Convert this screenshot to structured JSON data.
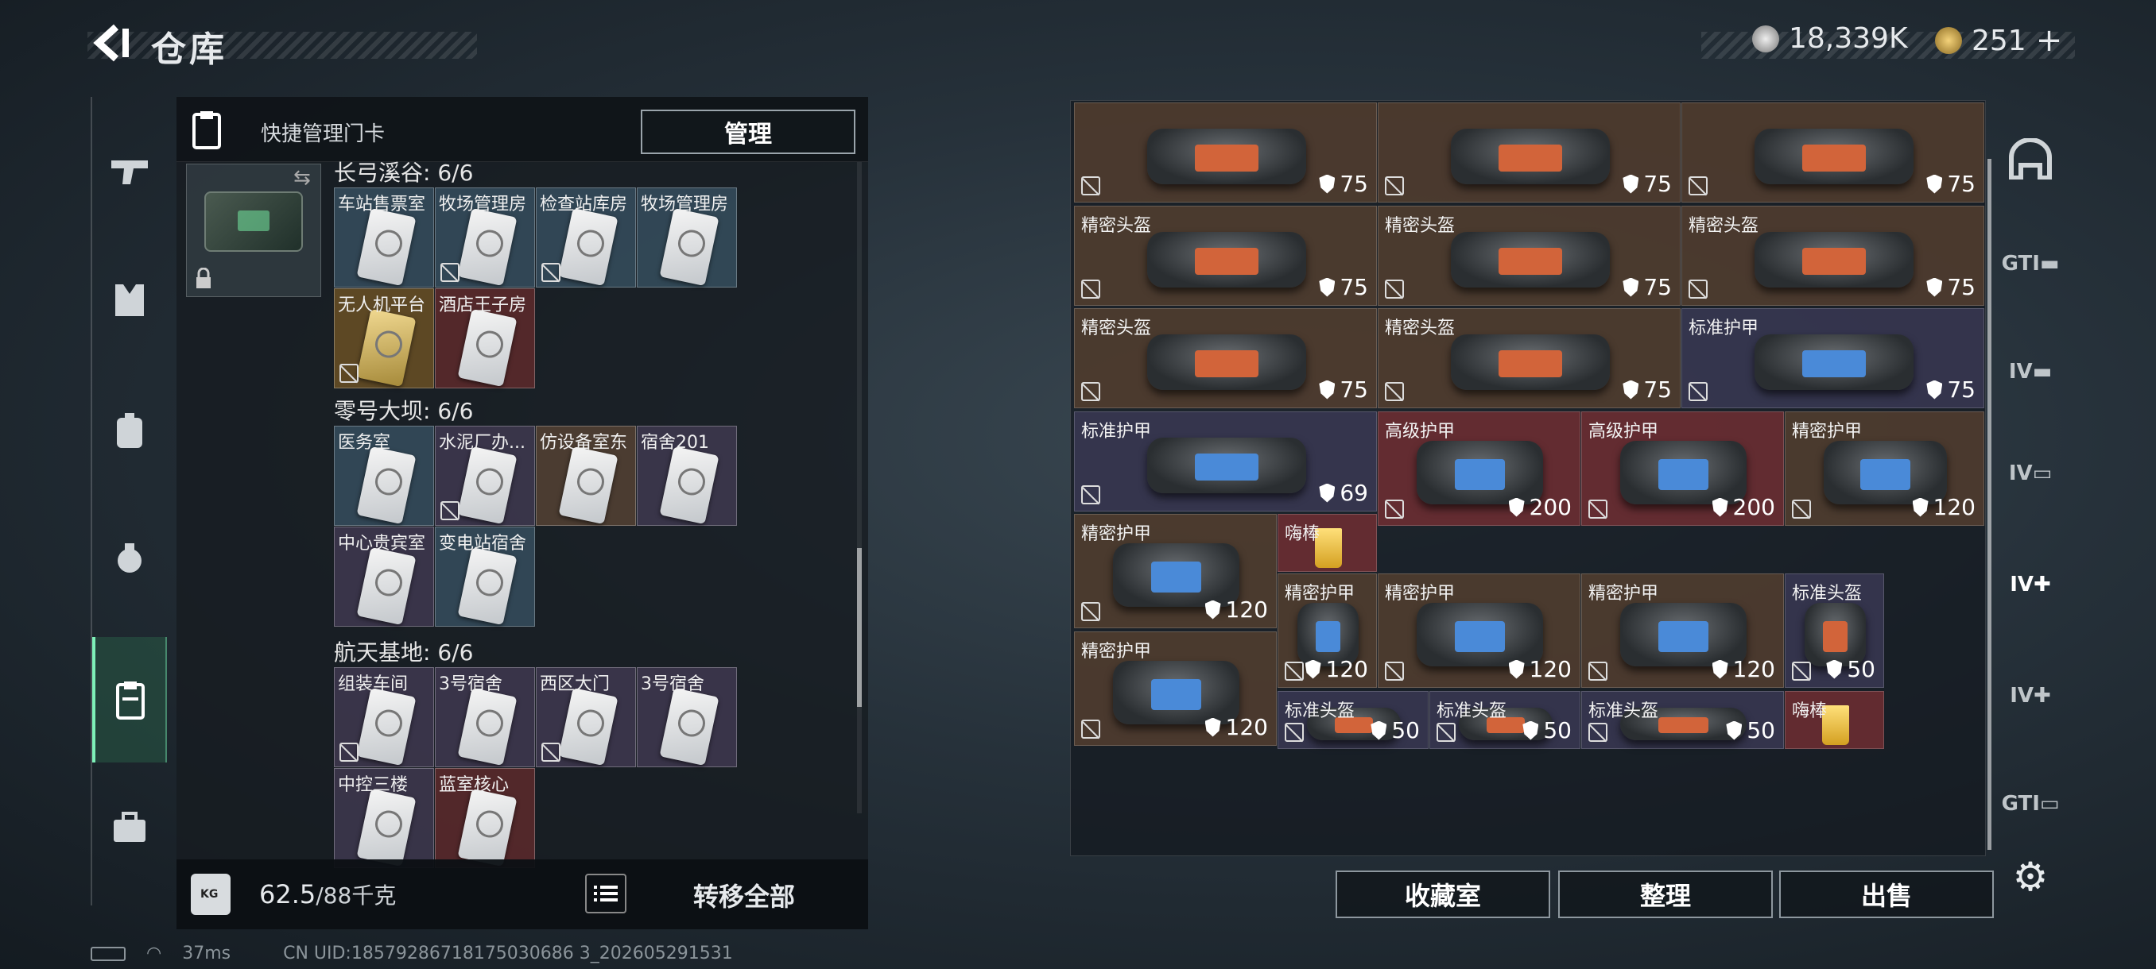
{
  "header": {
    "title": "仓库",
    "currency1": "18,339K",
    "currency2": "251",
    "currency2_plus": "+"
  },
  "left_panel": {
    "key_label": "快捷管理门卡",
    "manage_label": "管理",
    "sections": [
      {
        "title": "长弓溪谷: 6/6",
        "slots": [
          {
            "label": "车站售票室",
            "bg": "blue",
            "nosell": false
          },
          {
            "label": "牧场管理房",
            "bg": "blue",
            "nosell": true
          },
          {
            "label": "检查站库房",
            "bg": "blue",
            "nosell": true
          },
          {
            "label": "牧场管理房",
            "bg": "blue",
            "nosell": false
          },
          {
            "label": "无人机平台",
            "bg": "gold",
            "nosell": true
          },
          {
            "label": "酒店王子房",
            "bg": "red",
            "nosell": false
          }
        ]
      },
      {
        "title": "零号大坝: 6/6",
        "slots": [
          {
            "label": "医务室",
            "bg": "blue",
            "nosell": false
          },
          {
            "label": "水泥厂办...",
            "bg": "purple",
            "nosell": true
          },
          {
            "label": "仿设备室东",
            "bg": "brown",
            "nosell": false
          },
          {
            "label": "宿舍201",
            "bg": "purple",
            "nosell": false
          },
          {
            "label": "中心贵宾室",
            "bg": "purple",
            "nosell": false
          },
          {
            "label": "变电站宿舍",
            "bg": "blue",
            "nosell": false
          }
        ]
      },
      {
        "title": "航天基地: 6/6",
        "slots": [
          {
            "label": "组装车间",
            "bg": "purple",
            "nosell": true
          },
          {
            "label": "3号宿舍",
            "bg": "purple",
            "nosell": false
          },
          {
            "label": "西区大门",
            "bg": "purple",
            "nosell": true
          },
          {
            "label": "3号宿舍",
            "bg": "purple",
            "nosell": false
          },
          {
            "label": "中控三楼",
            "bg": "purple",
            "nosell": false
          },
          {
            "label": "蓝室核心",
            "bg": "red",
            "nosell": false
          }
        ]
      }
    ],
    "weight_current": "62.5",
    "weight_max": "/88千克",
    "transfer_label": "转移全部"
  },
  "grid": [
    {
      "name": "",
      "dur": "75"
    },
    {
      "name": "",
      "dur": "75"
    },
    {
      "name": "",
      "dur": "75"
    },
    {
      "name": "精密头盔",
      "dur": "75"
    },
    {
      "name": "精密头盔",
      "dur": "75"
    },
    {
      "name": "精密头盔",
      "dur": "75"
    },
    {
      "name": "精密头盔",
      "dur": "75"
    },
    {
      "name": "精密头盔",
      "dur": "75"
    },
    {
      "name": "标准护甲",
      "dur": "75"
    },
    {
      "name": "标准护甲",
      "dur": "69"
    },
    {
      "name": "高级护甲",
      "dur": "200"
    },
    {
      "name": "高级护甲",
      "dur": "200"
    },
    {
      "name": "精密护甲",
      "dur": "120"
    },
    {
      "name": "精密护甲",
      "dur": "120"
    },
    {
      "name": "嗨棒",
      "dur": ""
    },
    {
      "name": "精密护甲",
      "dur": "120"
    },
    {
      "name": "精密护甲",
      "dur": "120"
    },
    {
      "name": "精密护甲",
      "dur": "120"
    },
    {
      "name": "标准头盔",
      "dur": "50"
    },
    {
      "name": "精密护甲",
      "dur": "120"
    },
    {
      "name": "标准头盔",
      "dur": "50"
    },
    {
      "name": "标准头盔",
      "dur": "50"
    },
    {
      "name": "标准头盔",
      "dur": "50"
    },
    {
      "name": "嗨棒",
      "dur": ""
    }
  ],
  "bottom_buttons": {
    "collection": "收藏室",
    "organize": "整理",
    "sell": "出售"
  },
  "status": {
    "ping": "37ms",
    "uid": "CN UID:18579286718175030686 3_202605291531"
  },
  "colors": {
    "accent": "#7ef0b8",
    "rarity_gold": "#c9982c",
    "rarity_red": "#702e32",
    "rarity_purple": "#3a3854",
    "rarity_blue": "#3a5466"
  }
}
